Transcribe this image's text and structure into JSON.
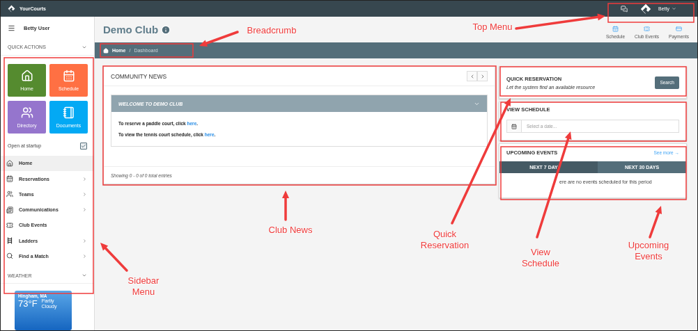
{
  "top_bar": {
    "brand": "YourCourts",
    "user": "Betty"
  },
  "sidebar": {
    "user": "Betty User",
    "quick_actions": {
      "title": "QUICK ACTIONS",
      "expanded": true,
      "tiles": [
        {
          "label": "Home",
          "kind": "home",
          "color": "#558b2f"
        },
        {
          "label": "Schedule",
          "kind": "calendar",
          "color": "#ff7043"
        },
        {
          "label": "Directory",
          "kind": "people",
          "color": "#9575cd"
        },
        {
          "label": "Documents",
          "kind": "notebook",
          "color": "#03a9f4"
        }
      ]
    },
    "open_at_startup": {
      "label": "Open at startup",
      "checked": true
    },
    "items": [
      {
        "label": "Home",
        "kind": "home",
        "selected": true,
        "submenu": false
      },
      {
        "label": "Reservations",
        "kind": "calendar",
        "selected": false,
        "submenu": true
      },
      {
        "label": "Teams",
        "kind": "people",
        "selected": false,
        "submenu": true
      },
      {
        "label": "Communications",
        "kind": "news",
        "selected": false,
        "submenu": true
      },
      {
        "label": "Club Events",
        "kind": "ticket",
        "selected": false,
        "submenu": false
      },
      {
        "label": "Ladders",
        "kind": "ladder",
        "selected": false,
        "submenu": true
      },
      {
        "label": "Find a Match",
        "kind": "search",
        "selected": false,
        "submenu": true
      }
    ],
    "weather": {
      "title": "WEATHER",
      "expanded": true,
      "location": "Hingham, MA",
      "temperature": "73°F",
      "condition": "Partly Cloudy"
    }
  },
  "header": {
    "title": "Demo Club",
    "links": [
      {
        "label": "Schedule",
        "kind": "calendar"
      },
      {
        "label": "Club Events",
        "kind": "ticket"
      },
      {
        "label": "Payments",
        "kind": "payment"
      }
    ]
  },
  "breadcrumb": {
    "items": [
      "Home",
      "Dashboard"
    ],
    "separator": "/"
  },
  "community_news": {
    "title": "COMMUNITY NEWS",
    "panel": {
      "title": "WELCOME TO DEMO CLUB",
      "expanded": true,
      "lines": [
        {
          "before": "To reserve a paddle court, click ",
          "link": "here",
          "after": "."
        },
        {
          "before": "To view the tennis court schedule, click ",
          "link": "here",
          "after": "."
        }
      ]
    },
    "footer": "Showing 0 - 0 of 0 total entries"
  },
  "quick_reservation": {
    "title": "QUICK RESERVATION",
    "subtitle": "Let the system find an available resource",
    "button": "Search"
  },
  "view_schedule": {
    "title": "VIEW SCHEDULE",
    "placeholder": "Select a date..."
  },
  "upcoming_events": {
    "title": "UPCOMING EVENTS",
    "see_more": "See more →",
    "tabs": [
      {
        "label": "NEXT 7 DAY",
        "selected": true
      },
      {
        "label": "NEXT 30 DAYS",
        "selected": false
      }
    ],
    "message": "ere are no events scheduled for this period"
  },
  "annotations": [
    {
      "text": "Breadcrumb"
    },
    {
      "text": "Top Menu"
    },
    {
      "text": "Club News"
    },
    {
      "text": "Quick Reservation"
    },
    {
      "text": "View Schedule"
    },
    {
      "text": "Upcoming Events"
    },
    {
      "text": "Sidebar Menu"
    }
  ]
}
